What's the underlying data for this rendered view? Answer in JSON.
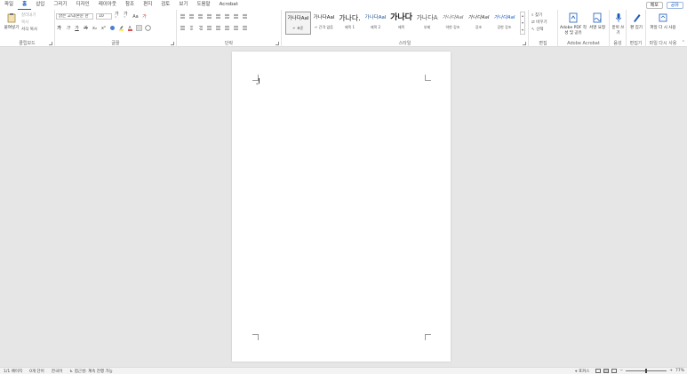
{
  "tabs": [
    "파일",
    "홈",
    "삽입",
    "그리기",
    "디자인",
    "레이아웃",
    "참조",
    "편지",
    "검토",
    "보기",
    "도움말",
    "Acrobat"
  ],
  "active_tab": "홈",
  "top_right": {
    "memo": "메모",
    "share": "공유"
  },
  "clipboard": {
    "paste": "붙여넣기",
    "cut": "잘라내기",
    "copy": "복사",
    "format_painter": "서식 복사",
    "label": "클립보드"
  },
  "font": {
    "name": "맑은 고딕(본문 한",
    "size": "10",
    "grow": "가ˆ",
    "shrink": "가ˇ",
    "case": "Aa",
    "clear": "가",
    "bold": "가",
    "italic": "가",
    "underline": "가",
    "strike": "가",
    "sub": "x₂",
    "sup": "x²",
    "label": "글꼴"
  },
  "paragraph": {
    "label": "단락"
  },
  "styles": {
    "label": "스타일",
    "items": [
      {
        "preview": "가나다AaI",
        "name": "↵ 표준"
      },
      {
        "preview": "가나다AaI",
        "name": "↵ 간격 없음"
      },
      {
        "preview": "가나다.",
        "name": "제목 1"
      },
      {
        "preview": "가나다AaI",
        "name": "제목 2"
      },
      {
        "preview": "가나다",
        "name": "제목"
      },
      {
        "preview": "가나다A",
        "name": "부제"
      },
      {
        "preview": "가나다AaI",
        "name": "약한 강조"
      },
      {
        "preview": "가나다AaI",
        "name": "강조"
      },
      {
        "preview": "가나다AaI",
        "name": "강한 강조"
      }
    ]
  },
  "editing": {
    "find": "찾기",
    "replace": "바꾸기",
    "select": "선택",
    "label": "편집"
  },
  "acrobat": {
    "create": "Adobe PDF 작성 및 공유",
    "sign": "서명 요청",
    "label": "Adobe Acrobat"
  },
  "voice": {
    "dictate": "받아 쓰기",
    "label": "음성"
  },
  "editor": {
    "btn": "편 집기",
    "label": "편집기"
  },
  "reuse": {
    "btn": "파일 다 시 사용",
    "label": "파일 다시 사용"
  },
  "status": {
    "page": "1/1 페이지",
    "words": "0개 단어",
    "lang": "한국어",
    "accessibility": "접근성: 계속 진행 가능",
    "focus": "포커스",
    "zoom": "77%"
  },
  "colors": {
    "accent": "#185abd",
    "ribbon": "#ffffff",
    "canvas": "#e6e6e6"
  }
}
